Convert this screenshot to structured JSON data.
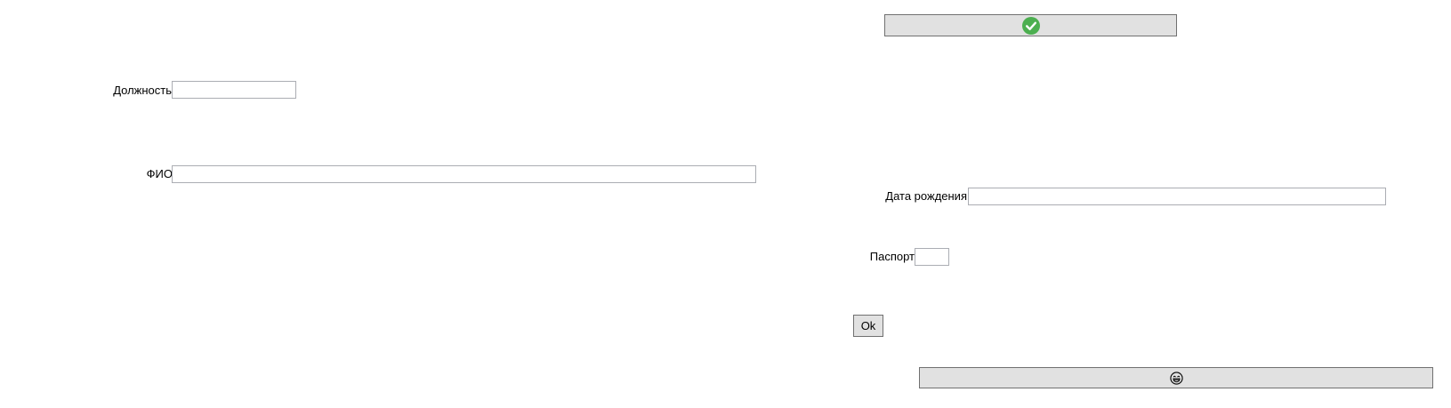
{
  "form": {
    "position_label": "Должность",
    "position_value": "",
    "fio_label": "ФИО",
    "fio_value": "",
    "birthdate_label": "Дата рождения",
    "birthdate_value": "",
    "passport_label": "Паспорт",
    "passport_value": ""
  },
  "buttons": {
    "confirm_icon": "check-circle-icon",
    "ok_label": "Ok",
    "emoji_icon": "laughing-face-icon"
  },
  "colors": {
    "button_bg": "#e1e1e1",
    "button_border": "#707070",
    "field_border": "#abadb3",
    "check_green": "#4caf50"
  }
}
